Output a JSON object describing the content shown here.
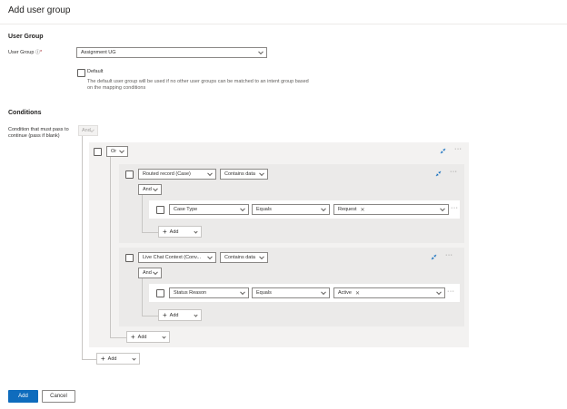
{
  "header": {
    "title": "Add user group"
  },
  "user_group_section": {
    "heading": "User Group",
    "field_label": "User Group",
    "info_glyph": "ⓘ",
    "required_mark": "*",
    "value": "Assignment UG",
    "default_label": "Default",
    "default_help": "The default user group will be used if no other user groups can be matched to an intent group based on the mapping conditions"
  },
  "conditions_section": {
    "heading": "Conditions",
    "field_label": "Condition that must pass to continue (pass if blank)",
    "top_operator": "And",
    "group_operator": "Or",
    "condition1": {
      "entity": "Routed record (Case)",
      "operator": "Contains data",
      "inner_operator": "And",
      "field": "Case Type",
      "comparator": "Equals",
      "value_tag": "Request",
      "add_label": "Add"
    },
    "condition2": {
      "entity": "Live Chat Context (Conv...",
      "operator": "Contains data",
      "inner_operator": "And",
      "field": "Status Reason",
      "comparator": "Equals",
      "value_tag": "Active",
      "add_label": "Add"
    },
    "group_add_label": "Add",
    "outer_add_label": "Add",
    "more_glyph": "···",
    "remove_glyph": "✕"
  },
  "footer": {
    "primary_label": "Add",
    "secondary_label": "Cancel"
  },
  "colors": {
    "primary": "#0f6cbd",
    "collapse_icon": "#0f6cbd"
  }
}
